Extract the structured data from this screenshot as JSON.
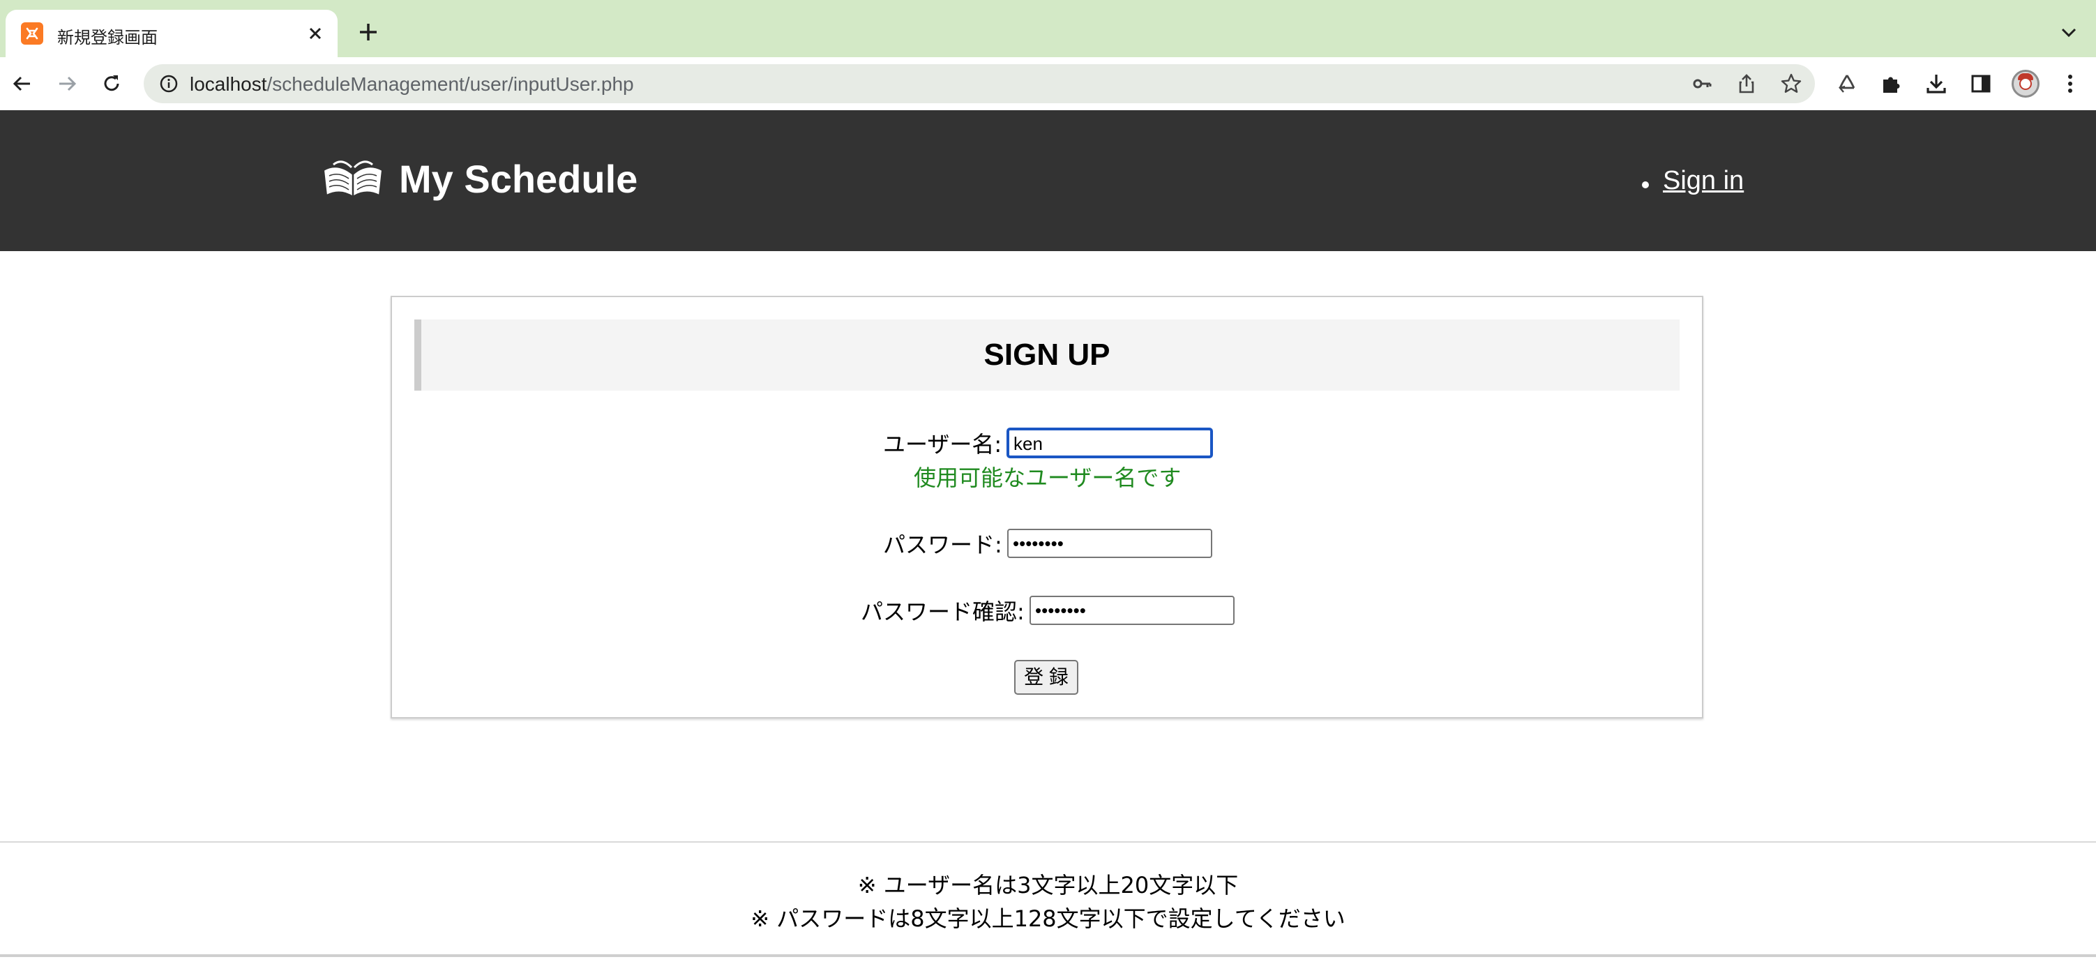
{
  "browser": {
    "tab_title": "新規登録画面",
    "url_host": "localhost",
    "url_path": "/scheduleManagement/user/inputUser.php"
  },
  "header": {
    "site_title": "My Schedule",
    "signin_label": "Sign in"
  },
  "form": {
    "heading": "SIGN UP",
    "username_label": "ユーザー名:",
    "username_value": "ken",
    "username_status": "使用可能なユーザー名です",
    "password_label": "パスワード:",
    "password_value": "••••••••",
    "password_confirm_label": "パスワード確認:",
    "password_confirm_value": "••••••••",
    "submit_label": "登 録"
  },
  "footer": {
    "note_username": "※ ユーザー名は3文字以上20文字以下",
    "note_password": "※ パスワードは8文字以上128文字以下で設定してください"
  },
  "colors": {
    "tabstrip": "#d3e9c6",
    "header_bg": "#333333",
    "status_green": "#1f8a1f",
    "focus_blue": "#1a56c4"
  }
}
